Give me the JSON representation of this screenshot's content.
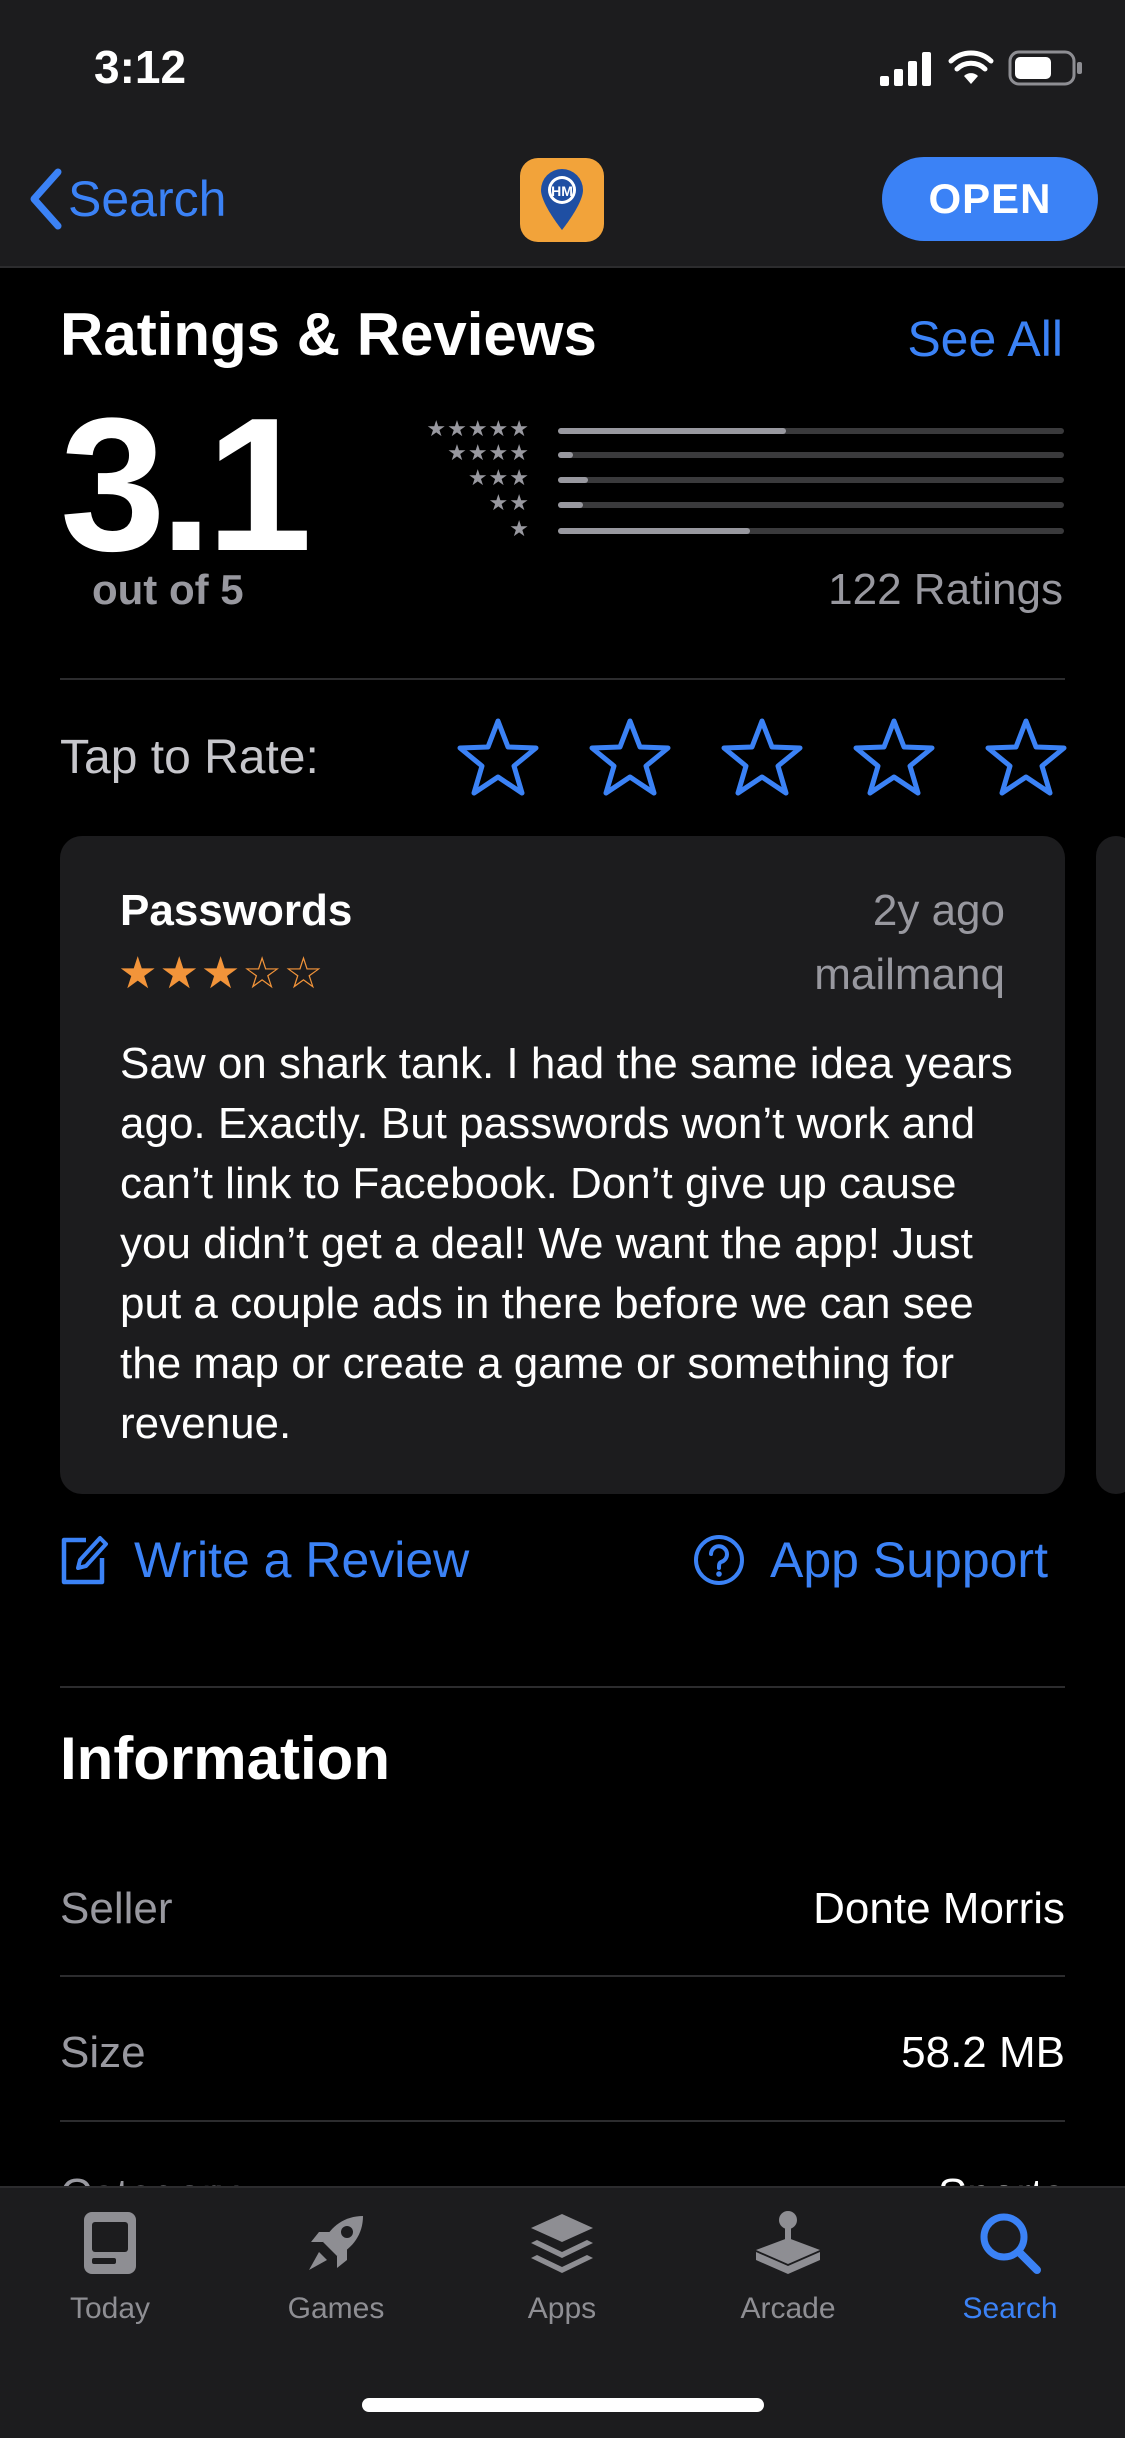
{
  "status_bar": {
    "time": "3:12"
  },
  "nav": {
    "back_label": "Search",
    "open_label": "OPEN",
    "app_icon": "map-pin-hm-icon",
    "app_icon_text": "HM"
  },
  "ratings": {
    "title": "Ratings & Reviews",
    "see_all": "See All",
    "average": "3.1",
    "out_of": "out of 5",
    "count": "122 Ratings",
    "distribution": [
      {
        "stars": "★★★★★",
        "fraction": 0.45
      },
      {
        "stars": "★★★★",
        "fraction": 0.03
      },
      {
        "stars": "★★★",
        "fraction": 0.06
      },
      {
        "stars": "★★",
        "fraction": 0.05
      },
      {
        "stars": "★",
        "fraction": 0.38
      }
    ]
  },
  "tap_to_rate": {
    "label": "Tap to Rate:",
    "stars": 5
  },
  "review": {
    "title": "Passwords",
    "date": "2y ago",
    "author": "mailmanq",
    "rating": 3,
    "stars_text": "★★★☆☆",
    "body": "Saw on shark tank. I had the same idea years ago. Exactly. But passwords won’t work and can’t link to Facebook. Don’t give up cause you didn’t get a deal! We want the app! Just put a couple ads in there before we can see the map or create a game or something for revenue."
  },
  "actions": {
    "write_review": "Write a Review",
    "app_support": "App Support"
  },
  "information": {
    "title": "Information",
    "rows": [
      {
        "label": "Seller",
        "value": "Donte Morris"
      },
      {
        "label": "Size",
        "value": "58.2 MB"
      },
      {
        "label": "Category",
        "value": "Sports"
      }
    ]
  },
  "tabs": [
    {
      "label": "Today",
      "icon": "today-icon"
    },
    {
      "label": "Games",
      "icon": "rocket-icon"
    },
    {
      "label": "Apps",
      "icon": "layers-icon"
    },
    {
      "label": "Arcade",
      "icon": "joystick-icon"
    },
    {
      "label": "Search",
      "icon": "search-icon",
      "active": true
    }
  ],
  "colors": {
    "accent": "#3b82f6",
    "star_orange": "#f2943a",
    "app_icon_bg": "#f2a33a"
  }
}
